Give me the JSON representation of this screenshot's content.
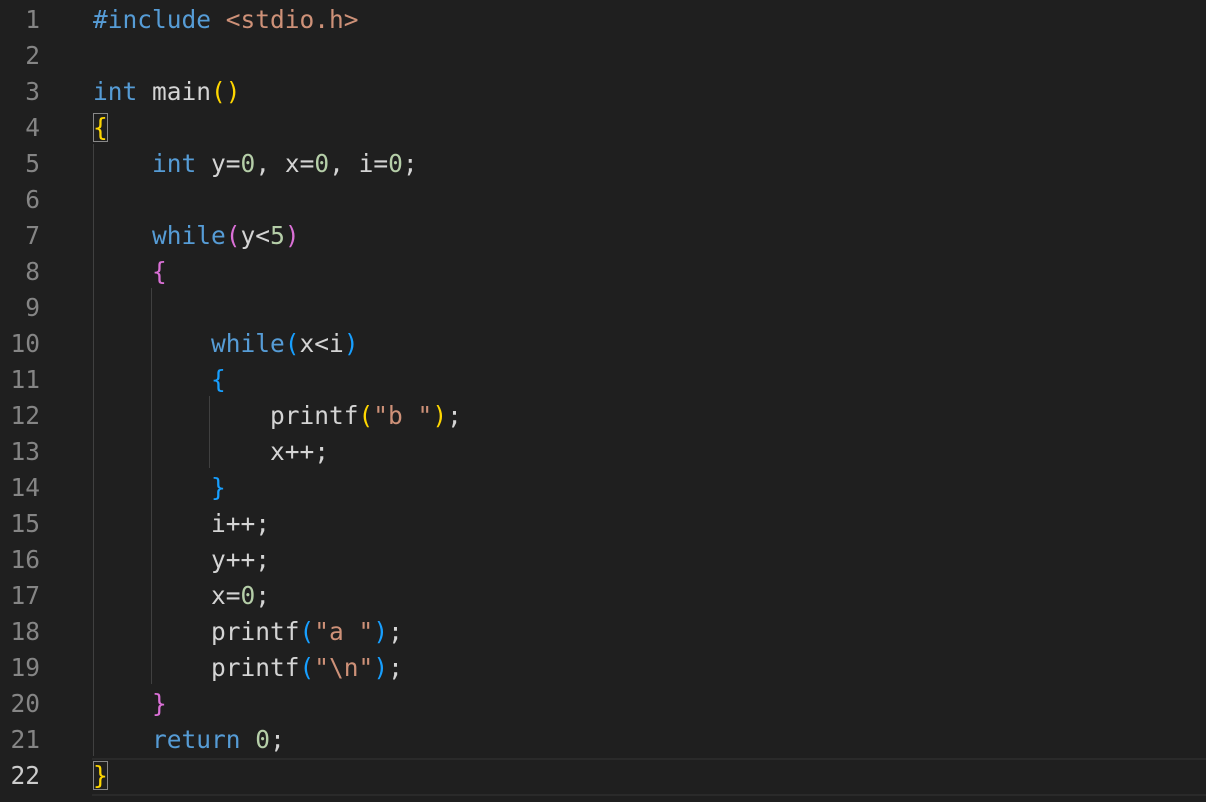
{
  "editor": {
    "active_line": 22,
    "line_numbers": [
      "1",
      "2",
      "3",
      "4",
      "5",
      "6",
      "7",
      "8",
      "9",
      "10",
      "11",
      "12",
      "13",
      "14",
      "15",
      "16",
      "17",
      "18",
      "19",
      "20",
      "21",
      "22"
    ],
    "lines": [
      [
        {
          "t": "#include",
          "c": "preproc"
        },
        {
          "t": " ",
          "c": "plain"
        },
        {
          "t": "<stdio.h>",
          "c": "string"
        }
      ],
      [],
      [
        {
          "t": "int",
          "c": "keyword"
        },
        {
          "t": " main",
          "c": "plain"
        },
        {
          "t": "()",
          "c": "br1"
        }
      ],
      [
        {
          "t": "{",
          "c": "br1",
          "m": true
        }
      ],
      [
        {
          "t": "    ",
          "c": "plain"
        },
        {
          "t": "int",
          "c": "keyword"
        },
        {
          "t": " y=",
          "c": "plain"
        },
        {
          "t": "0",
          "c": "number"
        },
        {
          "t": ", x=",
          "c": "plain"
        },
        {
          "t": "0",
          "c": "number"
        },
        {
          "t": ", i=",
          "c": "plain"
        },
        {
          "t": "0",
          "c": "number"
        },
        {
          "t": ";",
          "c": "plain"
        }
      ],
      [],
      [
        {
          "t": "    ",
          "c": "plain"
        },
        {
          "t": "while",
          "c": "keyword"
        },
        {
          "t": "(",
          "c": "br2"
        },
        {
          "t": "y<",
          "c": "plain"
        },
        {
          "t": "5",
          "c": "number"
        },
        {
          "t": ")",
          "c": "br2"
        }
      ],
      [
        {
          "t": "    ",
          "c": "plain"
        },
        {
          "t": "{",
          "c": "br2"
        }
      ],
      [],
      [
        {
          "t": "        ",
          "c": "plain"
        },
        {
          "t": "while",
          "c": "keyword"
        },
        {
          "t": "(",
          "c": "br3"
        },
        {
          "t": "x<i",
          "c": "plain"
        },
        {
          "t": ")",
          "c": "br3"
        }
      ],
      [
        {
          "t": "        ",
          "c": "plain"
        },
        {
          "t": "{",
          "c": "br3"
        }
      ],
      [
        {
          "t": "            ",
          "c": "plain"
        },
        {
          "t": "printf",
          "c": "plain"
        },
        {
          "t": "(",
          "c": "br1"
        },
        {
          "t": "\"b \"",
          "c": "string"
        },
        {
          "t": ")",
          "c": "br1"
        },
        {
          "t": ";",
          "c": "plain"
        }
      ],
      [
        {
          "t": "            ",
          "c": "plain"
        },
        {
          "t": "x++;",
          "c": "plain"
        }
      ],
      [
        {
          "t": "        ",
          "c": "plain"
        },
        {
          "t": "}",
          "c": "br3"
        }
      ],
      [
        {
          "t": "        ",
          "c": "plain"
        },
        {
          "t": "i++;",
          "c": "plain"
        }
      ],
      [
        {
          "t": "        ",
          "c": "plain"
        },
        {
          "t": "y++;",
          "c": "plain"
        }
      ],
      [
        {
          "t": "        ",
          "c": "plain"
        },
        {
          "t": "x=",
          "c": "plain"
        },
        {
          "t": "0",
          "c": "number"
        },
        {
          "t": ";",
          "c": "plain"
        }
      ],
      [
        {
          "t": "        ",
          "c": "plain"
        },
        {
          "t": "printf",
          "c": "plain"
        },
        {
          "t": "(",
          "c": "br3"
        },
        {
          "t": "\"a \"",
          "c": "string"
        },
        {
          "t": ")",
          "c": "br3"
        },
        {
          "t": ";",
          "c": "plain"
        }
      ],
      [
        {
          "t": "        ",
          "c": "plain"
        },
        {
          "t": "printf",
          "c": "plain"
        },
        {
          "t": "(",
          "c": "br3"
        },
        {
          "t": "\"\\n\"",
          "c": "string"
        },
        {
          "t": ")",
          "c": "br3"
        },
        {
          "t": ";",
          "c": "plain"
        }
      ],
      [
        {
          "t": "    ",
          "c": "plain"
        },
        {
          "t": "}",
          "c": "br2"
        }
      ],
      [
        {
          "t": "    ",
          "c": "plain"
        },
        {
          "t": "return",
          "c": "keyword"
        },
        {
          "t": " ",
          "c": "plain"
        },
        {
          "t": "0",
          "c": "number"
        },
        {
          "t": ";",
          "c": "plain"
        }
      ],
      [
        {
          "t": "}",
          "c": "br1",
          "m": true
        }
      ]
    ]
  },
  "theme": {
    "background": "#1f1f1f",
    "line_number": "#858585",
    "keyword": "#569cd6",
    "string": "#ce9178",
    "number": "#b5cea8",
    "text": "#d4d4d4",
    "bracket_1": "#ffd700",
    "bracket_2": "#da70d6",
    "bracket_3": "#179fff"
  }
}
